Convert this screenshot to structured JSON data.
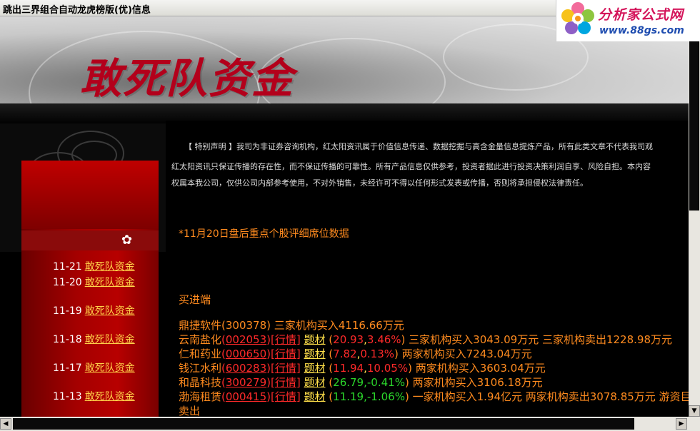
{
  "window": {
    "title": "跳出三界组合自动龙虎榜版(优)信息"
  },
  "logo": {
    "brand": "分析家公式网",
    "url": "www.88gs.com"
  },
  "banner": {
    "title": "敢死队资金"
  },
  "sidebar": {
    "items": [
      {
        "date": "11-21",
        "label": "敢死队资金"
      },
      {
        "date": "11-20",
        "label": "敢死队资金"
      },
      {
        "date": "11-19",
        "label": "敢死队资金"
      },
      {
        "date": "11-18",
        "label": "敢死队资金"
      },
      {
        "date": "11-17",
        "label": "敢死队资金"
      },
      {
        "date": "11-13",
        "label": "敢死队资金"
      }
    ]
  },
  "notice": {
    "line1": "【 特别声明 】我司为非证券咨询机构，红太阳资讯属于价值信息传递、数据挖掘与高含金量信息提炼产品，所有此类文章不代表我司观",
    "line2": "红太阳资讯只保证传播的存在性，而不保证传播的可靠性。所有产品信息仅供参考，投资者据此进行投资决策利润自享、风险自担。本内容",
    "line3": "权属本我公司，仅供公司内部参考使用，不对外销售，未经许可不得以任何形式发表或传播，否则将承担侵权法律责任。"
  },
  "section_title": "*11月20日盘后重点个股评细席位数据",
  "buy_label": "买进端",
  "quote_label": "行情",
  "topic_label": "题材",
  "stocks": [
    {
      "name": "鼎捷软件",
      "code": "300378",
      "desc": "三家机构买入4116.66万元"
    },
    {
      "name": "云南盐化",
      "code": "002053",
      "price": "20.93",
      "pct": "3.46%",
      "dir": "up",
      "desc": "三家机构买入3043.09万元 三家机构卖出1228.98万元"
    },
    {
      "name": "仁和药业",
      "code": "000650",
      "price": "7.82",
      "pct": "0.13%",
      "dir": "up",
      "desc": "两家机构买入7243.04万元"
    },
    {
      "name": "钱江水利",
      "code": "600283",
      "price": "11.94",
      "pct": "10.05%",
      "dir": "up",
      "desc": "两家机构买入3603.04万元"
    },
    {
      "name": "和晶科技",
      "code": "300279",
      "price": "26.79",
      "pct": "-0.41%",
      "dir": "dn",
      "desc": "两家机构买入3106.18万元"
    },
    {
      "name": "渤海租赁",
      "code": "000415",
      "price": "11.19",
      "pct": "-1.06%",
      "dir": "dn",
      "desc": "一家机构买入1.94亿元 两家机构卖出3078.85万元 游资巨大幅",
      "desc2": "卖出"
    }
  ]
}
